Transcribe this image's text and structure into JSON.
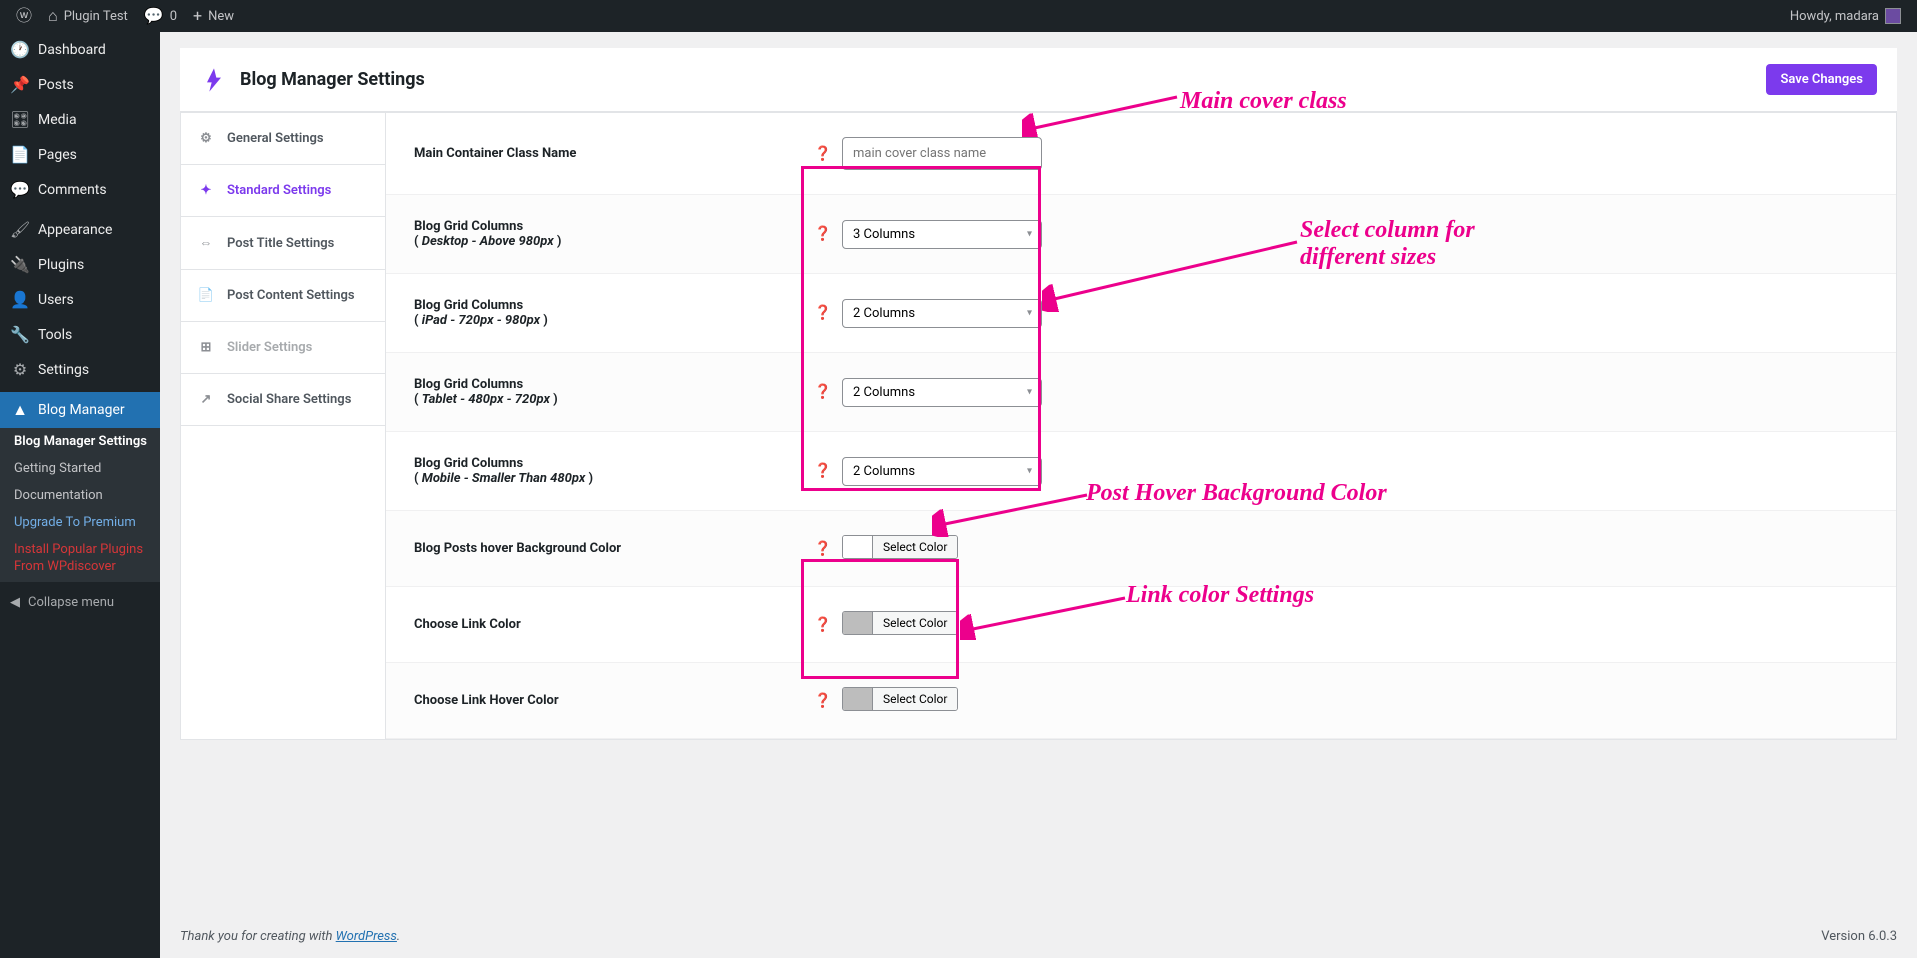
{
  "adminbar": {
    "site_name": "Plugin Test",
    "comments_count": "0",
    "new_label": "New",
    "howdy": "Howdy, madara"
  },
  "adminmenu": {
    "items": [
      {
        "icon": "dashboard",
        "label": "Dashboard"
      },
      {
        "icon": "pin",
        "label": "Posts"
      },
      {
        "icon": "media",
        "label": "Media"
      },
      {
        "icon": "page",
        "label": "Pages"
      },
      {
        "icon": "comment",
        "label": "Comments"
      },
      {
        "sep": true
      },
      {
        "icon": "appearance",
        "label": "Appearance"
      },
      {
        "icon": "plugin",
        "label": "Plugins"
      },
      {
        "icon": "user",
        "label": "Users"
      },
      {
        "icon": "tool",
        "label": "Tools"
      },
      {
        "icon": "settings",
        "label": "Settings"
      },
      {
        "sep": true
      },
      {
        "icon": "flame",
        "label": "Blog Manager",
        "current": true
      }
    ],
    "submenu": [
      {
        "label": "Blog Manager Settings",
        "current": true
      },
      {
        "label": "Getting Started"
      },
      {
        "label": "Documentation"
      },
      {
        "label": "Upgrade To Premium",
        "blue": true
      },
      {
        "label": "Install Popular Plugins From WPdiscover",
        "red": true
      }
    ],
    "collapse": "Collapse menu"
  },
  "page": {
    "title": "Blog Manager Settings",
    "save": "Save Changes"
  },
  "tabs": [
    {
      "icon": "⚙",
      "label": "General Settings"
    },
    {
      "icon": "✦",
      "label": "Standard Settings",
      "active": true
    },
    {
      "icon": "⇔",
      "label": "Post Title Settings"
    },
    {
      "icon": "📄",
      "label": "Post Content Settings"
    },
    {
      "icon": "⊞",
      "label": "Slider Settings",
      "muted": true
    },
    {
      "icon": "↗",
      "label": "Social Share Settings"
    }
  ],
  "fields": {
    "main_class": {
      "label": "Main Container Class Name",
      "placeholder": "main cover class name"
    },
    "grid1": {
      "label": "Blog Grid Columns",
      "sub": "Desktop - Above 980px",
      "value": "3 Columns"
    },
    "grid2": {
      "label": "Blog Grid Columns",
      "sub": "iPad - 720px - 980px",
      "value": "2 Columns"
    },
    "grid3": {
      "label": "Blog Grid Columns",
      "sub": "Tablet - 480px - 720px",
      "value": "2 Columns"
    },
    "grid4": {
      "label": "Blog Grid Columns",
      "sub": "Mobile - Smaller Than 480px",
      "value": "2 Columns"
    },
    "hover_bg": {
      "label": "Blog Posts hover Background Color",
      "btn": "Select Color"
    },
    "link_color": {
      "label": "Choose Link Color",
      "btn": "Select Color"
    },
    "link_hover": {
      "label": "Choose Link Hover Color",
      "btn": "Select Color"
    }
  },
  "annotations": {
    "main_cover": "Main cover class",
    "columns": "Select column for different sizes",
    "hover_bg": "Post Hover Background Color",
    "link": "Link color Settings"
  },
  "footer": {
    "thanks_prefix": "Thank you for creating with ",
    "wordpress": "WordPress",
    "thanks_suffix": ".",
    "version": "Version 6.0.3"
  }
}
